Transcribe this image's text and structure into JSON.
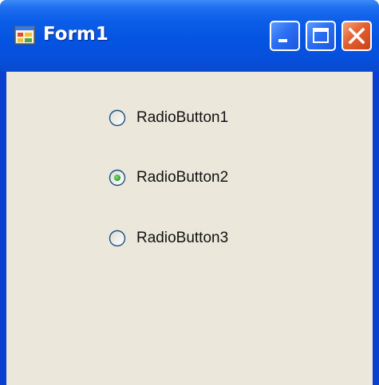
{
  "window": {
    "title": "Form1",
    "icon": "form-app-icon"
  },
  "caption_buttons": [
    {
      "name": "minimize",
      "icon": "minimize-icon"
    },
    {
      "name": "maximize",
      "icon": "maximize-icon"
    },
    {
      "name": "close",
      "icon": "close-icon"
    }
  ],
  "radio_buttons": [
    {
      "label": "RadioButton1",
      "checked": false
    },
    {
      "label": "RadioButton2",
      "checked": true
    },
    {
      "label": "RadioButton3",
      "checked": false
    }
  ],
  "colors": {
    "client_background": "#ebe8db",
    "titlebar_blue": "#0554e1",
    "radio_check_green": "#3eb03a"
  }
}
